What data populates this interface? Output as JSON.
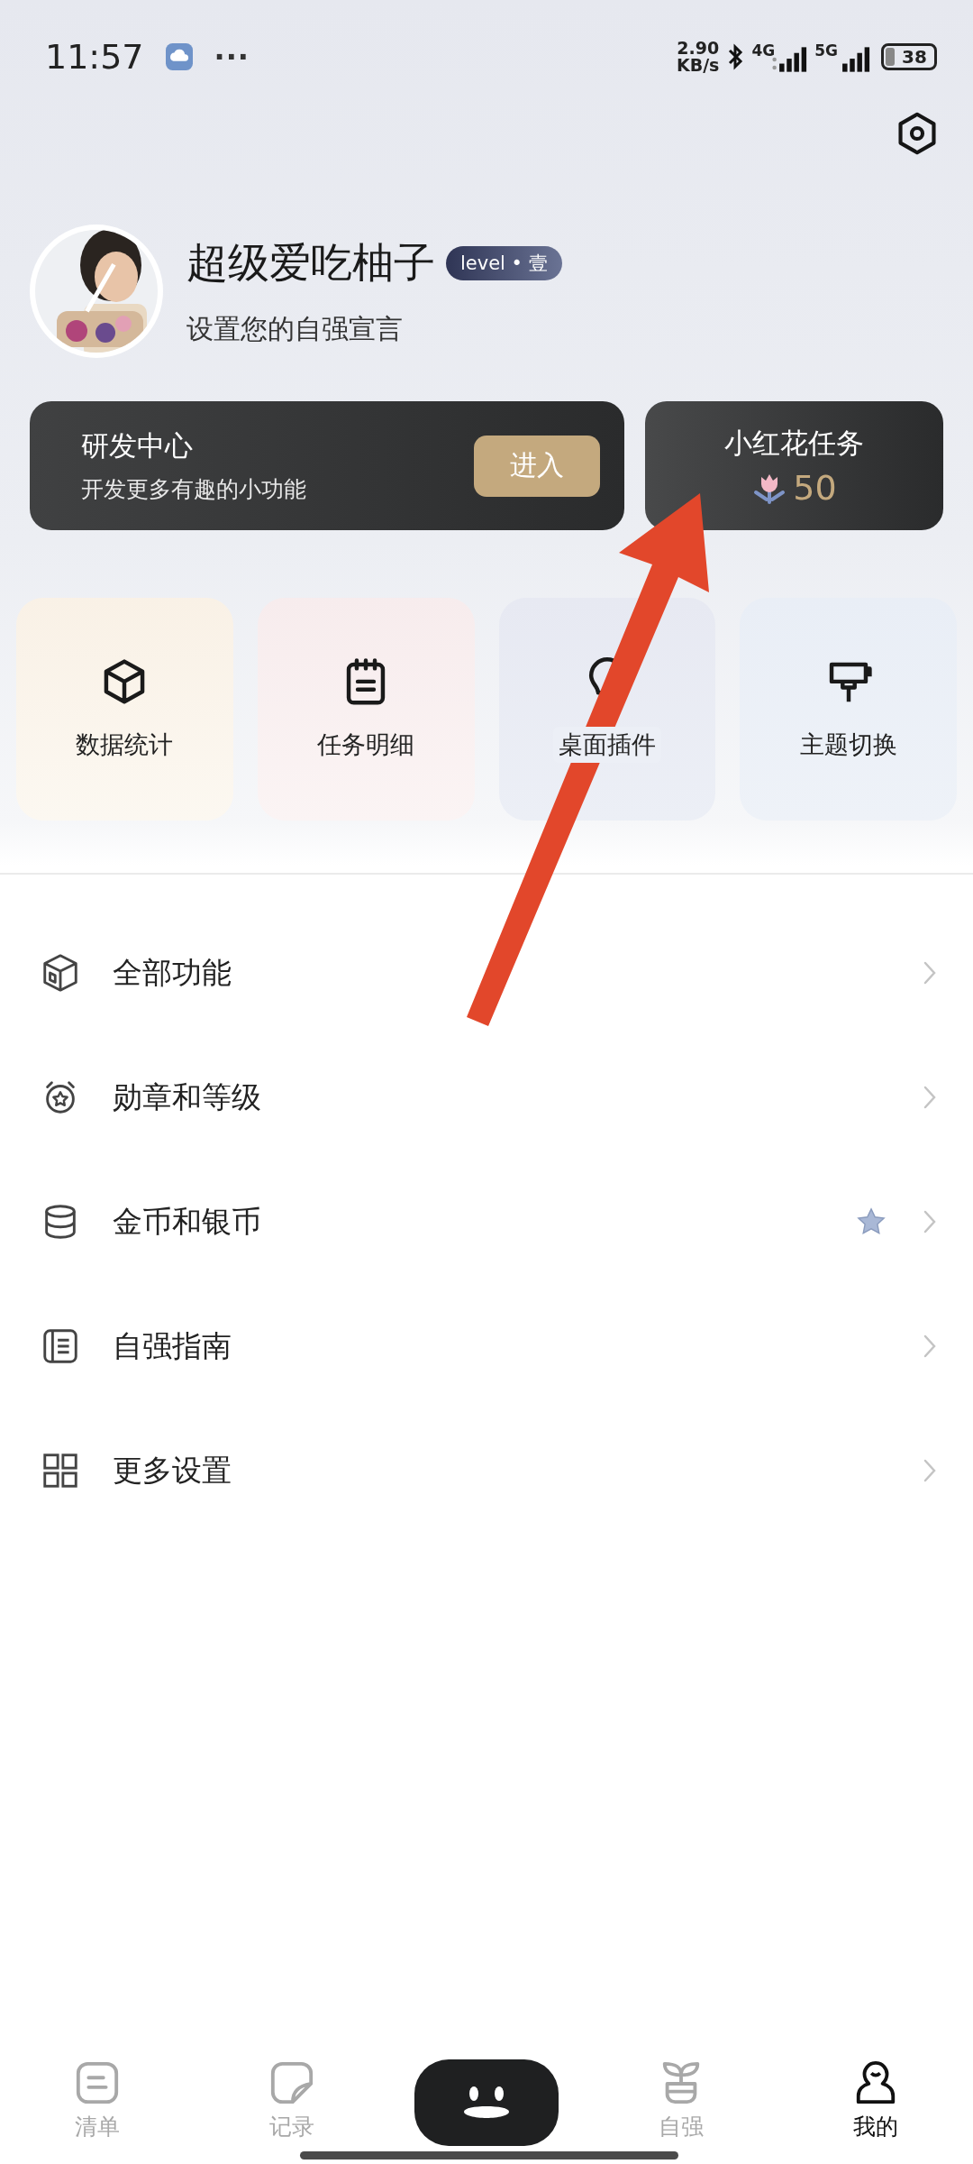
{
  "status_bar": {
    "time": "11:57",
    "more": "···",
    "speed_value": "2.90",
    "speed_unit": "KB/s",
    "sim1": "4G",
    "sim2": "5G",
    "battery": "38"
  },
  "profile": {
    "name": "超级爱吃柚子",
    "badge": "level • 壹",
    "motto": "设置您的自强宣言"
  },
  "dev_card": {
    "title": "研发中心",
    "subtitle": "开发更多有趣的小功能",
    "button": "进入"
  },
  "flower_card": {
    "title": "小红花任务",
    "count": "50"
  },
  "shortcuts": [
    {
      "label": "数据统计"
    },
    {
      "label": "任务明细"
    },
    {
      "label": "桌面插件"
    },
    {
      "label": "主题切换"
    }
  ],
  "menu": [
    {
      "label": "全部功能",
      "badge": false
    },
    {
      "label": "勋章和等级",
      "badge": false
    },
    {
      "label": "金币和银币",
      "badge": true
    },
    {
      "label": "自强指南",
      "badge": false
    },
    {
      "label": "更多设置",
      "badge": false
    }
  ],
  "nav": [
    {
      "label": "清单",
      "selected": false
    },
    {
      "label": "记录",
      "selected": false
    },
    {
      "label": "自强",
      "selected": false
    },
    {
      "label": "我的",
      "selected": true
    }
  ]
}
